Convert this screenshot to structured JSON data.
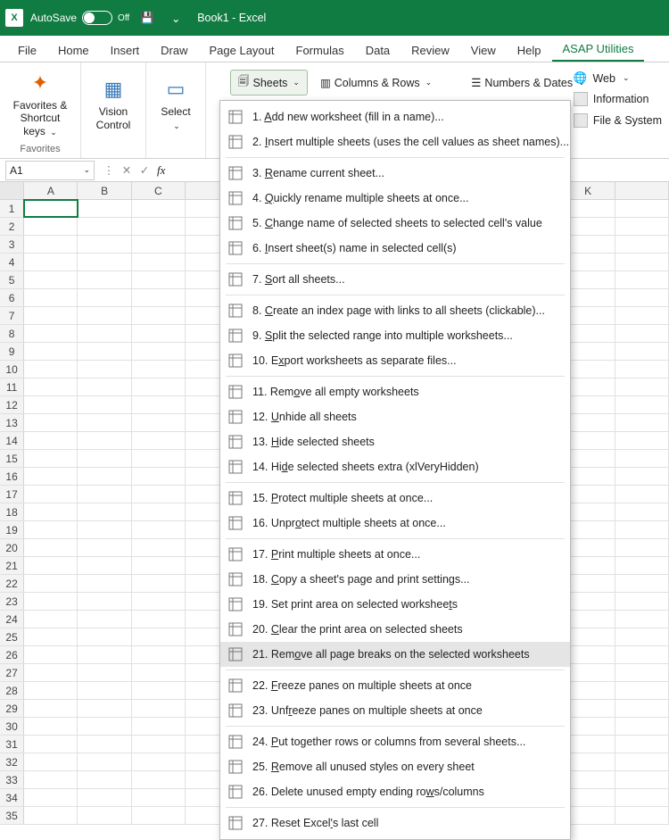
{
  "titlebar": {
    "autosave_label": "AutoSave",
    "autosave_state": "Off",
    "doc_title": "Book1  -  Excel"
  },
  "tabs": [
    "File",
    "Home",
    "Insert",
    "Draw",
    "Page Layout",
    "Formulas",
    "Data",
    "Review",
    "View",
    "Help",
    "ASAP Utilities"
  ],
  "active_tab": "ASAP Utilities",
  "ribbon": {
    "favorites": "Favorites &\nShortcut keys",
    "favorites_group": "Favorites",
    "vision": "Vision\nControl",
    "select": "Select",
    "sheets": "Sheets",
    "columns": "Columns & Rows",
    "numbers": "Numbers & Dates",
    "web": "Web",
    "information": "Information",
    "filesystem": "File & System"
  },
  "namebox": "A1",
  "columns": [
    "A",
    "B",
    "C",
    "",
    "",
    "",
    "",
    "",
    "",
    "",
    "K",
    ""
  ],
  "row_count": 35,
  "selected_cell": {
    "row": 1,
    "col": 0
  },
  "menu": {
    "highlighted_index": 20,
    "items": [
      {
        "n": "1",
        "label": "Add new worksheet (fill in a name)...",
        "u": [
          0
        ]
      },
      {
        "n": "2",
        "label": "Insert multiple sheets (uses the cell values as sheet names)...",
        "u": [
          0
        ]
      },
      {
        "sep": true
      },
      {
        "n": "3",
        "label": "Rename current sheet...",
        "u": [
          0
        ]
      },
      {
        "n": "4",
        "label": "Quickly rename multiple sheets at once...",
        "u": [
          0
        ]
      },
      {
        "n": "5",
        "label": "Change name of selected sheets to selected cell's value",
        "u": [
          0
        ]
      },
      {
        "n": "6",
        "label": "Insert sheet(s) name in selected cell(s)",
        "u": [
          0
        ]
      },
      {
        "sep": true
      },
      {
        "n": "7",
        "label": "Sort all sheets...",
        "u": [
          0
        ]
      },
      {
        "sep": true
      },
      {
        "n": "8",
        "label": "Create an index page with links to all sheets (clickable)...",
        "u": [
          0
        ]
      },
      {
        "n": "9",
        "label": "Split the selected range into multiple worksheets...",
        "u": [
          0
        ]
      },
      {
        "n": "10",
        "label": "Export worksheets as separate files...",
        "u": [
          1
        ]
      },
      {
        "sep": true
      },
      {
        "n": "11",
        "label": "Remove all empty worksheets",
        "u": [
          3
        ]
      },
      {
        "n": "12",
        "label": "Unhide all sheets",
        "u": [
          0
        ]
      },
      {
        "n": "13",
        "label": "Hide selected sheets",
        "u": [
          0
        ]
      },
      {
        "n": "14",
        "label": "Hide selected sheets extra (xlVeryHidden)",
        "u": [
          2
        ]
      },
      {
        "sep": true
      },
      {
        "n": "15",
        "label": "Protect multiple sheets at once...",
        "u": [
          0
        ]
      },
      {
        "n": "16",
        "label": "Unprotect multiple sheets at once...",
        "u": [
          4
        ]
      },
      {
        "sep": true
      },
      {
        "n": "17",
        "label": "Print multiple sheets at once...",
        "u": [
          0
        ]
      },
      {
        "n": "18",
        "label": "Copy a sheet's page and print settings...",
        "u": [
          0
        ]
      },
      {
        "n": "19",
        "label": "Set print area on selected worksheets",
        "u": [
          35
        ]
      },
      {
        "n": "20",
        "label": "Clear the print area on selected sheets",
        "u": [
          0
        ]
      },
      {
        "n": "21",
        "label": "Remove all page breaks on the selected worksheets",
        "u": [
          3
        ]
      },
      {
        "sep": true
      },
      {
        "n": "22",
        "label": "Freeze panes on multiple sheets at once",
        "u": [
          0
        ]
      },
      {
        "n": "23",
        "label": "Unfreeze panes on multiple sheets at once",
        "u": [
          3
        ]
      },
      {
        "sep": true
      },
      {
        "n": "24",
        "label": "Put together rows or columns from several sheets...",
        "u": [
          0
        ]
      },
      {
        "n": "25",
        "label": "Remove all unused styles on every sheet",
        "u": [
          0
        ]
      },
      {
        "n": "26",
        "label": "Delete unused empty ending rows/columns",
        "u": [
          29
        ]
      },
      {
        "sep": true
      },
      {
        "n": "27",
        "label": "Reset Excel's last cell",
        "u": [
          11
        ]
      }
    ]
  }
}
